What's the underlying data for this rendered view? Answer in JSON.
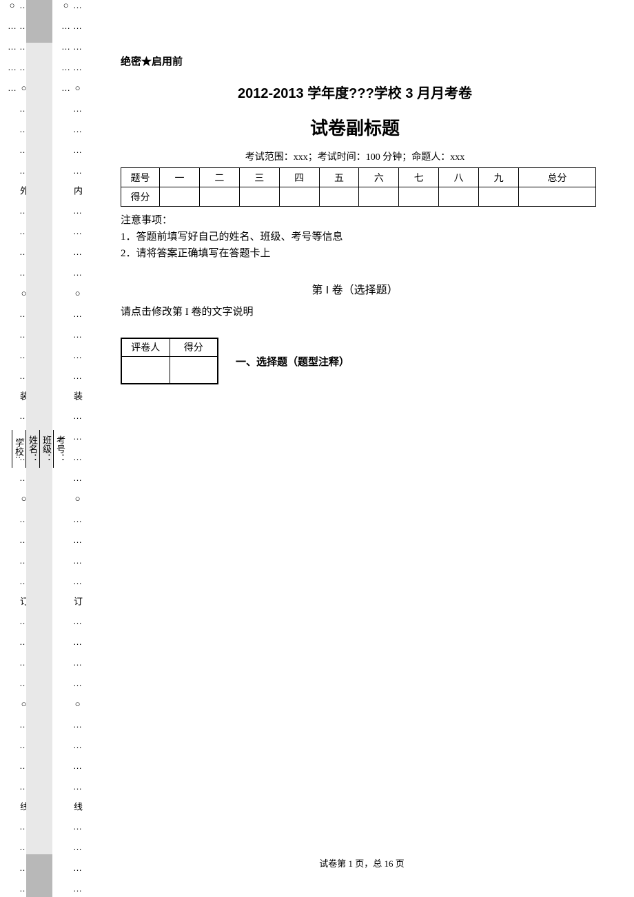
{
  "header": {
    "secret": "绝密★启用前",
    "title1": "2012-2013 学年度???学校 3 月月考卷",
    "title2": "试卷副标题",
    "exam_info": "考试范围：xxx；考试时间：100 分钟；命题人：xxx"
  },
  "score_table": {
    "row1": [
      "题号",
      "一",
      "二",
      "三",
      "四",
      "五",
      "六",
      "七",
      "八",
      "九",
      "总分"
    ],
    "row2_label": "得分"
  },
  "notice": {
    "heading": "注意事项：",
    "item1": "1．答题前填写好自己的姓名、班级、考号等信息",
    "item2": "2．请将答案正确填写在答题卡上"
  },
  "section": {
    "title": "第 I 卷（选择题）",
    "desc": "请点击修改第 I 卷的文字说明"
  },
  "grader": {
    "col1": "评卷人",
    "col2": "得分"
  },
  "question_heading": "一、选择题（题型注释）",
  "margin": {
    "outer": "… … … … ○ … … … … 外 … … … … ○ … … … … 装 … … … … ○ … … … … 订 … … … … ○ … … … … 线 … … … … ○ … … … …",
    "inner": "… … … … ○ … … … … 内 … … … … ○ … … … … 装 … … … … ○ … … … … 订 … … … … ○ … … … … 线 … … … … ○ … … … …",
    "school": "学校:",
    "name": "姓名：",
    "class": "班级：",
    "examno": "考号："
  },
  "footer": "试卷第 1 页，总 16 页"
}
